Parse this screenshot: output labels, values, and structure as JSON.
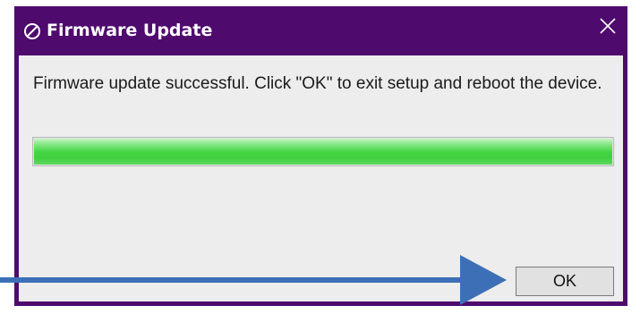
{
  "window": {
    "title": "Firmware Update",
    "title_icon": "prohibited-circle-icon",
    "close_icon": "close-icon"
  },
  "message": "Firmware update successful. Click \"OK\" to exit setup and reboot the device.",
  "progress": {
    "percent": 100
  },
  "buttons": {
    "ok_label": "OK"
  },
  "annotation": {
    "arrow_icon": "arrow-right-icon",
    "color": "#3d6fb6"
  },
  "colors": {
    "titlebar": "#4f0a6e",
    "client": "#ededed",
    "progress_fill": "#43d443"
  }
}
